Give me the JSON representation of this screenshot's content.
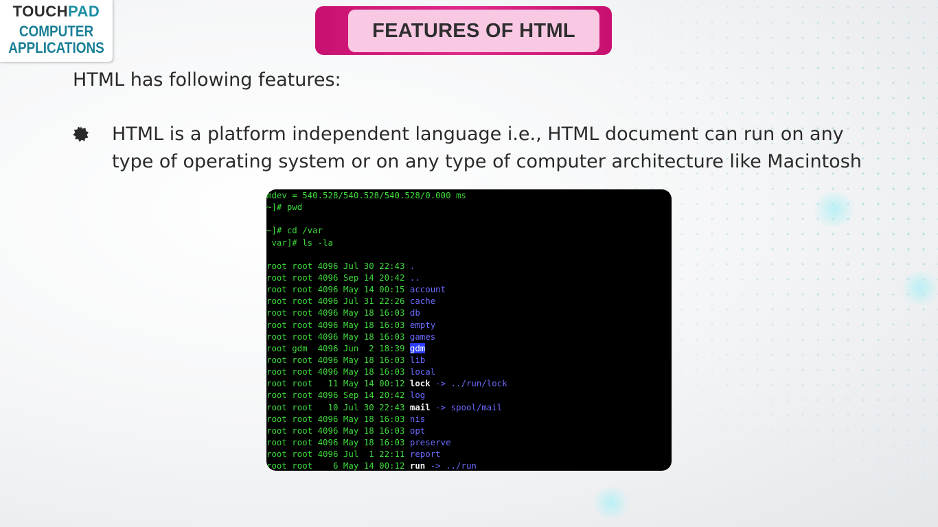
{
  "logo": {
    "brand_left": "TOUCH",
    "brand_right": "PAD",
    "line1": "COMPUTER",
    "line2": "APPLICATIONS"
  },
  "slide": {
    "title": "FEATURES OF HTML",
    "intro": "HTML has following features:",
    "bullet_icon": "gear-bullet-icon",
    "bullet_text": "HTML is a platform independent language i.e., HTML document can run on any type of operating system or on any type of computer architecture like Macintosh"
  },
  "colors": {
    "title_bar": "#d81b7e",
    "title_fill": "#f9c9e3",
    "terminal_bg": "#000000",
    "terminal_green": "#3edb3a",
    "terminal_blue": "#6b6bff"
  },
  "terminal": {
    "header_lines": [
      "mdev = 540.528/540.528/540.528/0.000 ms",
      "~]# pwd",
      "",
      "~]# cd /var",
      " var]# ls -la",
      ""
    ],
    "entries": [
      {
        "meta": "root root 4096 Jul 30 22:43 ",
        "name": ".",
        "target": ""
      },
      {
        "meta": "root root 4096 Sep 14 20:42 ",
        "name": "..",
        "target": ""
      },
      {
        "meta": "root root 4096 May 14 00:15 ",
        "name": "account",
        "target": ""
      },
      {
        "meta": "root root 4096 Jul 31 22:26 ",
        "name": "cache",
        "target": ""
      },
      {
        "meta": "root root 4096 May 18 16:03 ",
        "name": "db",
        "target": ""
      },
      {
        "meta": "root root 4096 May 18 16:03 ",
        "name": "empty",
        "target": ""
      },
      {
        "meta": "root root 4096 May 18 16:03 ",
        "name": "games",
        "target": ""
      },
      {
        "meta": "root gdm  4096 Jun  2 18:39 ",
        "name": "gdm",
        "target": "",
        "selected": true
      },
      {
        "meta": "root root 4096 May 18 16:03 ",
        "name": "lib",
        "target": ""
      },
      {
        "meta": "root root 4096 May 18 16:03 ",
        "name": "local",
        "target": ""
      },
      {
        "meta": "root root   11 May 14 00:12 ",
        "name": "lock",
        "target": "../run/lock",
        "link": true
      },
      {
        "meta": "root root 4096 Sep 14 20:42 ",
        "name": "log",
        "target": ""
      },
      {
        "meta": "root root   10 Jul 30 22:43 ",
        "name": "mail",
        "target": "spool/mail",
        "link": true
      },
      {
        "meta": "root root 4096 May 18 16:03 ",
        "name": "nis",
        "target": ""
      },
      {
        "meta": "root root 4096 May 18 16:03 ",
        "name": "opt",
        "target": ""
      },
      {
        "meta": "root root 4096 May 18 16:03 ",
        "name": "preserve",
        "target": ""
      },
      {
        "meta": "root root 4096 Jul  1 22:11 ",
        "name": "report",
        "target": ""
      },
      {
        "meta": "root root    6 May 14 00:12 ",
        "name": "run",
        "target": "../run",
        "link": true
      }
    ],
    "link_arrow": " -> "
  }
}
